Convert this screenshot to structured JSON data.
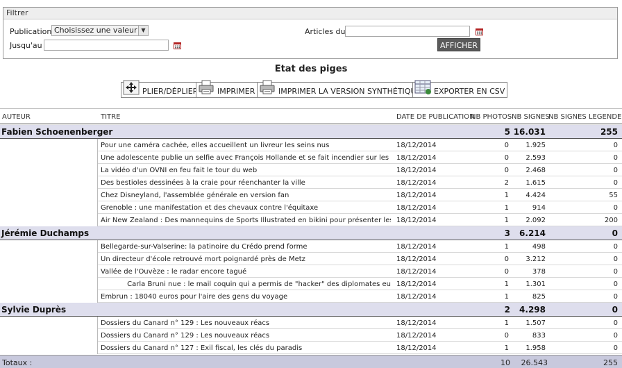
{
  "filter": {
    "legend": "Filtrer",
    "publication_label": "Publication :",
    "publication_value": "Choisissez une valeur",
    "articles_du_label": "Articles du :",
    "articles_du_value": "",
    "jusquau_label": "Jusqu'au :",
    "jusquau_value": "",
    "afficher_label": "AFFICHER"
  },
  "title": "Etat des piges",
  "toolbar": {
    "plier": "PLIER/DÉPLIER",
    "imprimer": "IMPRIMER",
    "imprimer_synth": "IMPRIMER LA VERSION SYNTHÉTIQUE",
    "exporter": "EXPORTER EN CSV"
  },
  "columns": {
    "auteur": "Auteur",
    "titre": "Titre",
    "date": "Date de publication",
    "photos": "Nb photos",
    "signes": "Nb signes",
    "legendes": "Nb signes legendes"
  },
  "groups": [
    {
      "author": "Fabien Schoenenberger",
      "photos": "5",
      "signes": "16.031",
      "legendes": "255",
      "articles": [
        {
          "title": "Pour une caméra cachée, elles accueillent un livreur les seins nus",
          "date": "18/12/2014",
          "photos": "0",
          "signes": "1.925",
          "legendes": "0"
        },
        {
          "title": "Une adolescente publie un selfie avec François Hollande et se fait incendier sur les réseaux sociaux",
          "date": "18/12/2014",
          "photos": "0",
          "signes": "2.593",
          "legendes": "0"
        },
        {
          "title": "La vidéo d'un OVNI en feu fait le tour du web",
          "date": "18/12/2014",
          "photos": "0",
          "signes": "2.468",
          "legendes": "0"
        },
        {
          "title": "Des bestioles dessinées à la craie pour réenchanter la ville",
          "date": "18/12/2014",
          "photos": "2",
          "signes": "1.615",
          "legendes": "0"
        },
        {
          "title": "Chez Disneyland, l'assemblée générale en version fan",
          "date": "18/12/2014",
          "photos": "1",
          "signes": "4.424",
          "legendes": "55"
        },
        {
          "title": "Grenoble : une manifestation et des chevaux contre l'équitaxe",
          "date": "18/12/2014",
          "photos": "1",
          "signes": "914",
          "legendes": "0"
        },
        {
          "title": "Air New Zealand : Des mannequins de Sports Illustrated en bikini pour présenter les règles de sécuri",
          "date": "18/12/2014",
          "photos": "1",
          "signes": "2.092",
          "legendes": "200"
        }
      ]
    },
    {
      "author": "Jérémie Duchamps",
      "photos": "3",
      "signes": "6.214",
      "legendes": "0",
      "articles": [
        {
          "title": "Bellegarde-sur-Valserine: la patinoire du Crédo prend forme",
          "date": "18/12/2014",
          "photos": "1",
          "signes": "498",
          "legendes": "0"
        },
        {
          "title": "Un directeur d'école retrouvé mort poignardé près de Metz",
          "date": "18/12/2014",
          "photos": "0",
          "signes": "3.212",
          "legendes": "0"
        },
        {
          "title": "Vallée de l'Ouvèze : le radar encore tagué",
          "date": "18/12/2014",
          "photos": "0",
          "signes": "378",
          "legendes": "0"
        },
        {
          "title": "            Carla Bruni nue : le mail coquin qui a permis de \"hacker\" des diplomates européens",
          "date": "18/12/2014",
          "photos": "1",
          "signes": "1.301",
          "legendes": "0"
        },
        {
          "title": "Embrun : 18040 euros pour l'aire des gens du voyage",
          "date": "18/12/2014",
          "photos": "1",
          "signes": "825",
          "legendes": "0"
        }
      ]
    },
    {
      "author": "Sylvie Duprès",
      "photos": "2",
      "signes": "4.298",
      "legendes": "0",
      "articles": [
        {
          "title": "Dossiers du Canard n° 129 : Les nouveaux réacs",
          "date": "18/12/2014",
          "photos": "1",
          "signes": "1.507",
          "legendes": "0"
        },
        {
          "title": "Dossiers du Canard n° 129 : Les nouveaux réacs",
          "date": "18/12/2014",
          "photos": "0",
          "signes": "833",
          "legendes": "0"
        },
        {
          "title": "Dossiers du Canard n° 127 : Exil fiscal, les clés du paradis",
          "date": "18/12/2014",
          "photos": "1",
          "signes": "1.958",
          "legendes": "0"
        }
      ]
    }
  ],
  "totals": {
    "label": "Totaux :",
    "photos": "10",
    "signes": "26.543",
    "legendes": "255"
  },
  "colors": {
    "group_bg": "#dedeed",
    "totals_bg": "#c8c9dd",
    "afficher_bg": "#5a5a5a",
    "calendar_icon": "#b22222"
  }
}
